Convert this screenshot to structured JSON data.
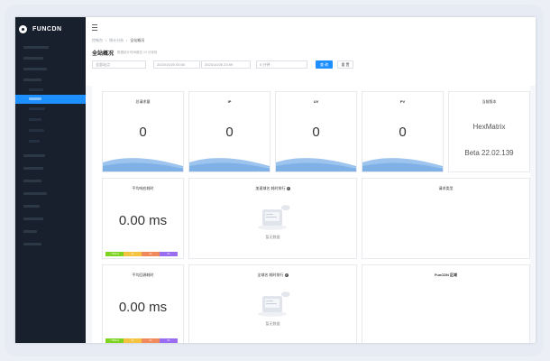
{
  "brand": {
    "name": "FUNCDN"
  },
  "breadcrumb": [
    "控制台",
    "统计分析",
    "全站概况"
  ],
  "page": {
    "title": "全站概况",
    "subtitle": "数据统计时间截至 10 分钟前"
  },
  "filters": {
    "domain_placeholder": "全部站点",
    "date_start": "2023/10/20 00:00",
    "date_end": "2023/10/26 23:59",
    "interval": "5 分钟",
    "search_label": "查 询",
    "reset_label": "重 置"
  },
  "stats": [
    {
      "label": "总请求量",
      "value": "0"
    },
    {
      "label": "IP",
      "value": "0"
    },
    {
      "label": "UV",
      "value": "0"
    },
    {
      "label": "PV",
      "value": "0"
    }
  ],
  "version": {
    "label": "当前版本",
    "product": "HexMatrix",
    "release": "Beta 22.02.139"
  },
  "avg_response": {
    "label": "平均响应耗时",
    "value": "0.00 ms"
  },
  "avg_origin": {
    "label": "平均回源耗时",
    "value": "0.00 ms"
  },
  "legend": [
    "< 500ms",
    "1s",
    "2s",
    "5s"
  ],
  "legend_colors": [
    "#7ed321",
    "#f5c342",
    "#f08a5d",
    "#9a6cf0"
  ],
  "ranking1": {
    "title": "加速域名 耗时排行",
    "empty": "暂无数据"
  },
  "request_type": {
    "title": "请求类型"
  },
  "ranking2": {
    "title": "全域名 耗时排行",
    "empty": "暂无数据"
  },
  "funcdn_region": {
    "title": "FunCDN 区域"
  },
  "colors": {
    "accent": "#1e8fff",
    "sidebar": "#17202c",
    "wave": "#9cc4ef"
  }
}
